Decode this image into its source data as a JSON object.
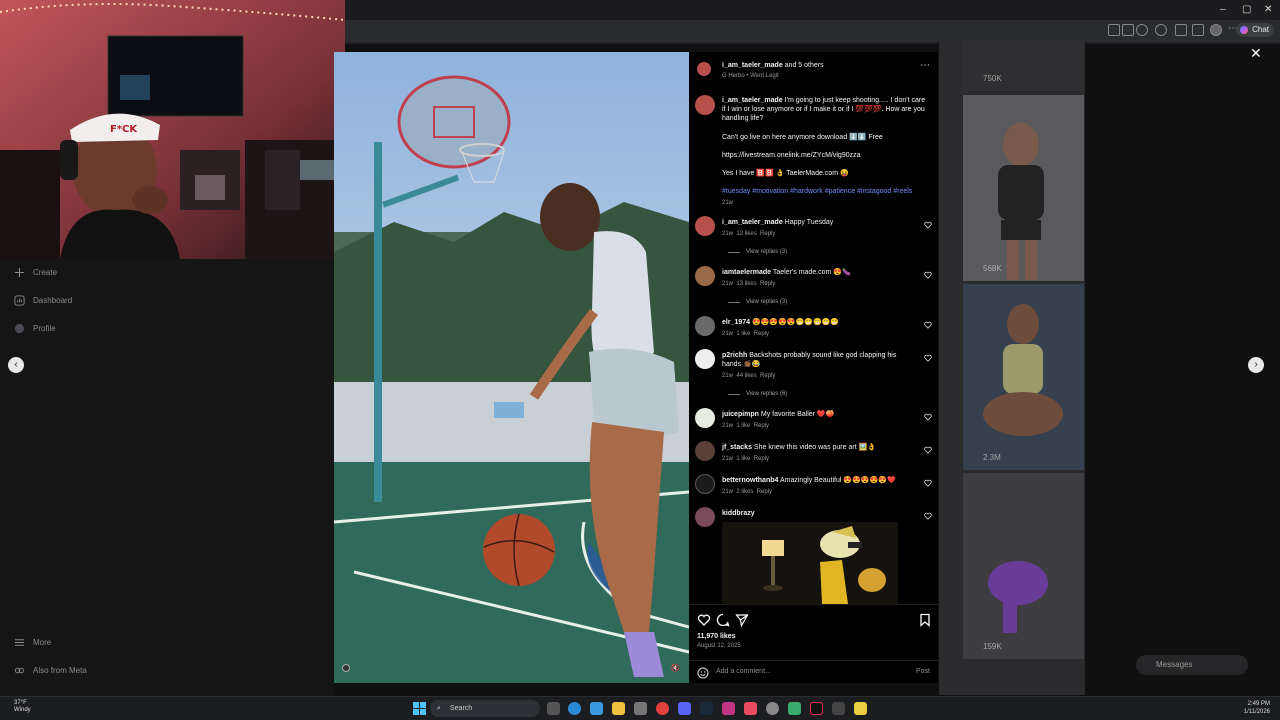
{
  "browser": {
    "chat_label": "Chat",
    "window_controls": [
      "–",
      "▢",
      "✕"
    ]
  },
  "left_nav": {
    "items": [
      {
        "label": "Create",
        "icon": "plus-icon"
      },
      {
        "label": "Dashboard",
        "icon": "dashboard-icon"
      },
      {
        "label": "Profile",
        "icon": "profile-icon"
      },
      {
        "label": "More",
        "icon": "menu-icon"
      },
      {
        "label": "Also from Meta",
        "icon": "meta-icon"
      }
    ]
  },
  "background_grid": {
    "counts": [
      "750K",
      "568K",
      "2.3M",
      "159K"
    ]
  },
  "post": {
    "header": {
      "username": "i_am_taeler_made",
      "and_others": " and 5 others",
      "audio": "G Herbo • Went Legit"
    },
    "caption": {
      "username": "i_am_taeler_made",
      "text": " I'm going to just keep shooting..... I don't care if I win or lose anymore or if I make it or if I 💯💯💯. How are you handling life?",
      "line2": "Can't go live on here anymore download ⬇️⬇️ Free",
      "line3": "https://livestream.onelink.me/ZYcM/vlg90zza",
      "line4": "Yes I have 🅱️🅱️ 👌 TaelerMade.com 😝",
      "tags": "#tuesday #motivation #hardwork #patience #instagood #reels",
      "time": "21w"
    },
    "comments": [
      {
        "user": "i_am_taeler_made",
        "text": " Happy Tuesday",
        "time": "21w",
        "likes": "12 likes",
        "reply": "Reply",
        "replies": "View replies (3)"
      },
      {
        "user": "iamtaelermade",
        "text": " Taeler's made.com 😍🍆",
        "time": "21w",
        "likes": "13 likes",
        "reply": "Reply",
        "replies": "View replies (3)"
      },
      {
        "user": "elr_1974",
        "text": " 😍😍😍😍😍😁😁😁😁😁",
        "time": "21w",
        "likes": "1 like",
        "reply": "Reply"
      },
      {
        "user": "p2richh",
        "text": " Backshots probably sound like god clapping his hands 👏🏾😂",
        "time": "21w",
        "likes": "44 likes",
        "reply": "Reply",
        "replies": "View replies (6)"
      },
      {
        "user": "juicepimpn",
        "text": " My favorite Baller ❤️🍑",
        "time": "21w",
        "likes": "1 like",
        "reply": "Reply"
      },
      {
        "user": "jf_stacks",
        "text": " She knew this video was pure art 🖼️👌",
        "time": "21w",
        "likes": "1 like",
        "reply": "Reply"
      },
      {
        "user": "betternowthanb4",
        "text": " Amazingly Beautiful 😍😍😍😍😍❤️",
        "time": "21w",
        "likes": "2 likes",
        "reply": "Reply"
      },
      {
        "user": "kiddbrazy",
        "text": ""
      }
    ],
    "likes": "11,970 likes",
    "date": "August 12, 2025",
    "add_comment_placeholder": "Add a comment...",
    "post_button": "Post"
  },
  "messages_label": "Messages",
  "taskbar": {
    "weather_temp": "37°F",
    "weather_desc": "Windy",
    "search_label": "Search",
    "time": "2:49 PM",
    "date": "1/11/2026"
  },
  "colors": {
    "hashtag": "#6b8ef8",
    "panel_bg": "#000000",
    "accent_heart": "#ffffff"
  }
}
